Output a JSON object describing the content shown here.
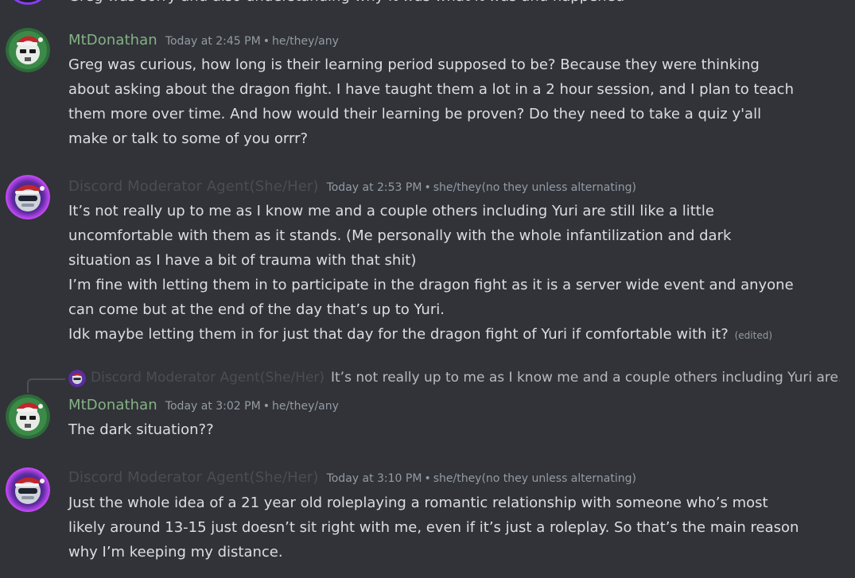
{
  "top_partial_text": "Greg  was  sorry  and  also  understanding  why  it  was  what  it  was  and  happened",
  "messages": [
    {
      "author": "MtDonathan",
      "timestamp": "Today at 2:45 PM",
      "pronouns": "he/they/any",
      "lines": [
        "Greg was curious, how long is their learning period supposed to be? Because they were thinking",
        "about asking about the dragon fight. I have taught them a lot in a 2 hour session, and I plan to teach",
        "them more over time. And how would their learning be proven? Do they need to take a quiz y'all",
        "make or talk to some of you orrr?"
      ]
    },
    {
      "author": "Discord Moderator Agent(She/Her)",
      "timestamp": "Today at 2:53 PM",
      "pronouns": "she/they(no they unless alternating)",
      "lines": [
        "It’s not really up to me as I know me and a couple others including Yuri are still like a little",
        "uncomfortable with them as it stands. (Me personally with the whole infantilization and dark",
        "situation as I have a bit of trauma with that shit)",
        "I’m fine with letting them in to participate in the dragon fight as it is a server wide event and anyone",
        "can come but at the end of the day that’s up to Yuri.",
        "Idk maybe letting them in for just that day for the dragon fight of Yuri if comfortable with it?"
      ],
      "edited": "(edited)"
    },
    {
      "author": "MtDonathan",
      "timestamp": "Today at 3:02 PM",
      "pronouns": "he/they/any",
      "reply_author": "Discord Moderator Agent(She/Her)",
      "reply_text": "It’s not really up to me as I know me and a couple others including Yuri are...",
      "lines": [
        "The dark situation??"
      ]
    },
    {
      "author": "Discord Moderator Agent(She/Her)",
      "timestamp": "Today at 3:10 PM",
      "pronouns": "she/they(no they unless alternating)",
      "lines": [
        "Just the whole idea of a 21 year old roleplaying a romantic relationship with someone who’s most",
        "likely around 13-15 just doesn’t sit right with me, even if it’s just a roleplay. So that’s the main reason",
        "why I’m keeping my distance."
      ]
    }
  ],
  "separator": "•",
  "colors": {
    "background": "#313338",
    "text": "#dbdee1",
    "muted": "#949ba4",
    "author_green": "#85b285",
    "author_faded": "#4b4d52"
  },
  "icons": {
    "mtdonathan_avatar": "green-skull-santa-hat-avatar",
    "moderator_avatar": "purple-glow-robot-santa-hat-avatar"
  }
}
